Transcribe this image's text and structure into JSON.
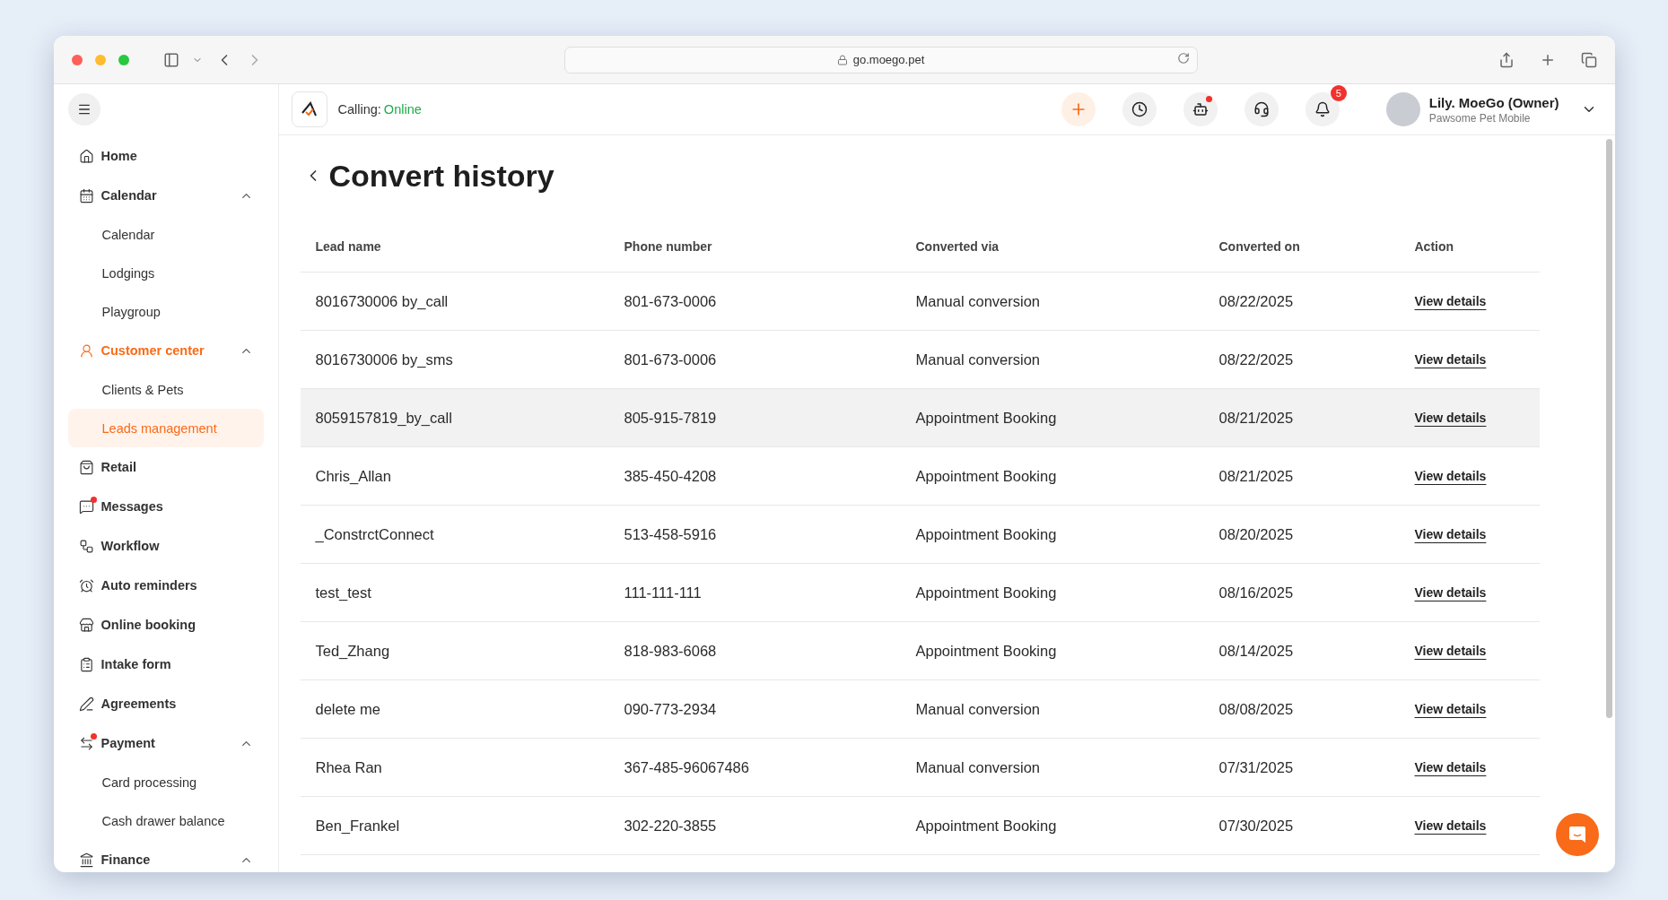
{
  "browser": {
    "url": "go.moego.pet"
  },
  "sidebar": {
    "items": [
      {
        "kind": "item",
        "label": "Home",
        "selected": false,
        "dot": false
      },
      {
        "kind": "group",
        "label": "Calendar",
        "selected": false,
        "dot": false,
        "expanded": true
      },
      {
        "kind": "sub",
        "label": "Calendar",
        "selected": false
      },
      {
        "kind": "sub",
        "label": "Lodgings",
        "selected": false
      },
      {
        "kind": "sub",
        "label": "Playgroup",
        "selected": false
      },
      {
        "kind": "group",
        "label": "Customer center",
        "selected": true,
        "dot": false,
        "expanded": true
      },
      {
        "kind": "sub",
        "label": "Clients & Pets",
        "selected": false
      },
      {
        "kind": "sub",
        "label": "Leads management",
        "selected": true
      },
      {
        "kind": "item",
        "label": "Retail",
        "selected": false,
        "dot": false
      },
      {
        "kind": "item",
        "label": "Messages",
        "selected": false,
        "dot": true
      },
      {
        "kind": "item",
        "label": "Workflow",
        "selected": false,
        "dot": false
      },
      {
        "kind": "item",
        "label": "Auto reminders",
        "selected": false,
        "dot": false
      },
      {
        "kind": "item",
        "label": "Online booking",
        "selected": false,
        "dot": false
      },
      {
        "kind": "item",
        "label": "Intake form",
        "selected": false,
        "dot": false
      },
      {
        "kind": "item",
        "label": "Agreements",
        "selected": false,
        "dot": false
      },
      {
        "kind": "group",
        "label": "Payment",
        "selected": false,
        "dot": true,
        "expanded": true
      },
      {
        "kind": "sub",
        "label": "Card processing",
        "selected": false
      },
      {
        "kind": "sub",
        "label": "Cash drawer balance",
        "selected": false
      },
      {
        "kind": "group",
        "label": "Finance",
        "selected": false,
        "dot": false,
        "expanded": true
      }
    ]
  },
  "header": {
    "calling_label": "Calling:",
    "calling_status": "Online",
    "notifications_count": "5",
    "user_name": "Lily. MoeGo (Owner)",
    "business": "Pawsome Pet Mobile"
  },
  "page": {
    "title": "Convert history"
  },
  "table": {
    "columns": [
      "Lead name",
      "Phone number",
      "Converted via",
      "Converted on",
      "Action"
    ],
    "rows": [
      {
        "lead": "8016730006 by_call",
        "phone": "801-673-0006",
        "via": "Manual conversion",
        "date": "08/22/2025",
        "action": "View details",
        "hovered": false
      },
      {
        "lead": "8016730006 by_sms",
        "phone": "801-673-0006",
        "via": "Manual conversion",
        "date": "08/22/2025",
        "action": "View details",
        "hovered": false
      },
      {
        "lead": "8059157819_by_call",
        "phone": "805-915-7819",
        "via": "Appointment Booking",
        "date": "08/21/2025",
        "action": "View details",
        "hovered": true
      },
      {
        "lead": "Chris_Allan",
        "phone": "385-450-4208",
        "via": "Appointment Booking",
        "date": "08/21/2025",
        "action": "View details",
        "hovered": false
      },
      {
        "lead": "_ConstrctConnect",
        "phone": "513-458-5916",
        "via": "Appointment Booking",
        "date": "08/20/2025",
        "action": "View details",
        "hovered": false
      },
      {
        "lead": "test_test",
        "phone": "111-111-111",
        "via": "Appointment Booking",
        "date": "08/16/2025",
        "action": "View details",
        "hovered": false
      },
      {
        "lead": "Ted_Zhang",
        "phone": "818-983-6068",
        "via": "Appointment Booking",
        "date": "08/14/2025",
        "action": "View details",
        "hovered": false
      },
      {
        "lead": "delete me",
        "phone": "090-773-2934",
        "via": "Manual conversion",
        "date": "08/08/2025",
        "action": "View details",
        "hovered": false
      },
      {
        "lead": "Rhea Ran",
        "phone": "367-485-96067486",
        "via": "Manual conversion",
        "date": "07/31/2025",
        "action": "View details",
        "hovered": false
      },
      {
        "lead": "Ben_Frankel",
        "phone": "302-220-3855",
        "via": "Appointment Booking",
        "date": "07/30/2025",
        "action": "View details",
        "hovered": false
      }
    ]
  }
}
